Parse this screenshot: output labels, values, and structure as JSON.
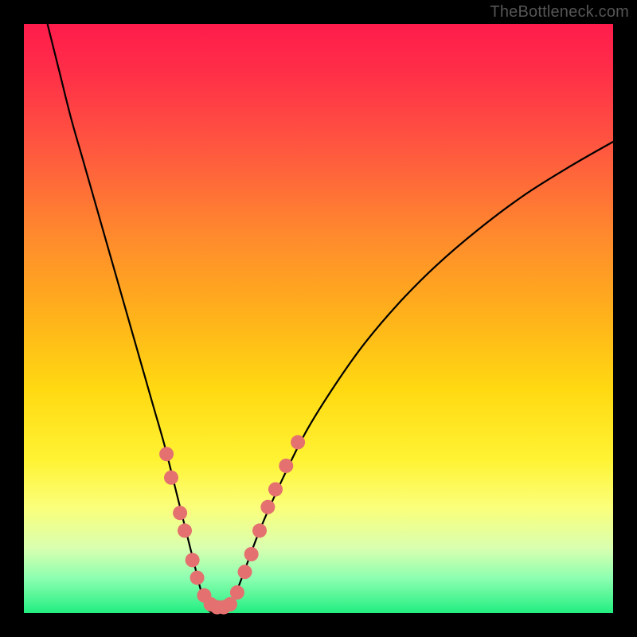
{
  "watermark": "TheBottleneck.com",
  "chart_data": {
    "type": "line",
    "title": "",
    "xlabel": "",
    "ylabel": "",
    "xlim": [
      0,
      100
    ],
    "ylim": [
      0,
      100
    ],
    "series": [
      {
        "name": "bottleneck-curve",
        "x": [
          4,
          6,
          8,
          10,
          12,
          14,
          16,
          18,
          20,
          22,
          24,
          26,
          27,
          28,
          29,
          30,
          31,
          32,
          33,
          34,
          35,
          37,
          40,
          44,
          48,
          53,
          58,
          64,
          70,
          77,
          85,
          93,
          100
        ],
        "values": [
          100,
          92,
          84,
          77,
          70,
          63,
          56,
          49,
          42,
          35,
          28,
          20,
          16,
          12,
          8,
          4,
          1,
          0,
          0,
          0,
          1,
          6,
          14,
          23,
          31,
          39,
          46,
          53,
          59,
          65,
          71,
          76,
          80
        ]
      }
    ],
    "markers": [
      {
        "name": "dot-cluster",
        "color": "#e4716f",
        "points": [
          {
            "x": 24.2,
            "y": 27
          },
          {
            "x": 25.0,
            "y": 23
          },
          {
            "x": 26.5,
            "y": 17
          },
          {
            "x": 27.3,
            "y": 14
          },
          {
            "x": 28.6,
            "y": 9
          },
          {
            "x": 29.4,
            "y": 6
          },
          {
            "x": 30.6,
            "y": 3
          },
          {
            "x": 31.7,
            "y": 1.5
          },
          {
            "x": 32.8,
            "y": 1
          },
          {
            "x": 33.9,
            "y": 1
          },
          {
            "x": 35.0,
            "y": 1.5
          },
          {
            "x": 36.2,
            "y": 3.5
          },
          {
            "x": 37.5,
            "y": 7
          },
          {
            "x": 38.6,
            "y": 10
          },
          {
            "x": 40.0,
            "y": 14
          },
          {
            "x": 41.4,
            "y": 18
          },
          {
            "x": 42.7,
            "y": 21
          },
          {
            "x": 44.5,
            "y": 25
          },
          {
            "x": 46.5,
            "y": 29
          }
        ]
      }
    ]
  }
}
